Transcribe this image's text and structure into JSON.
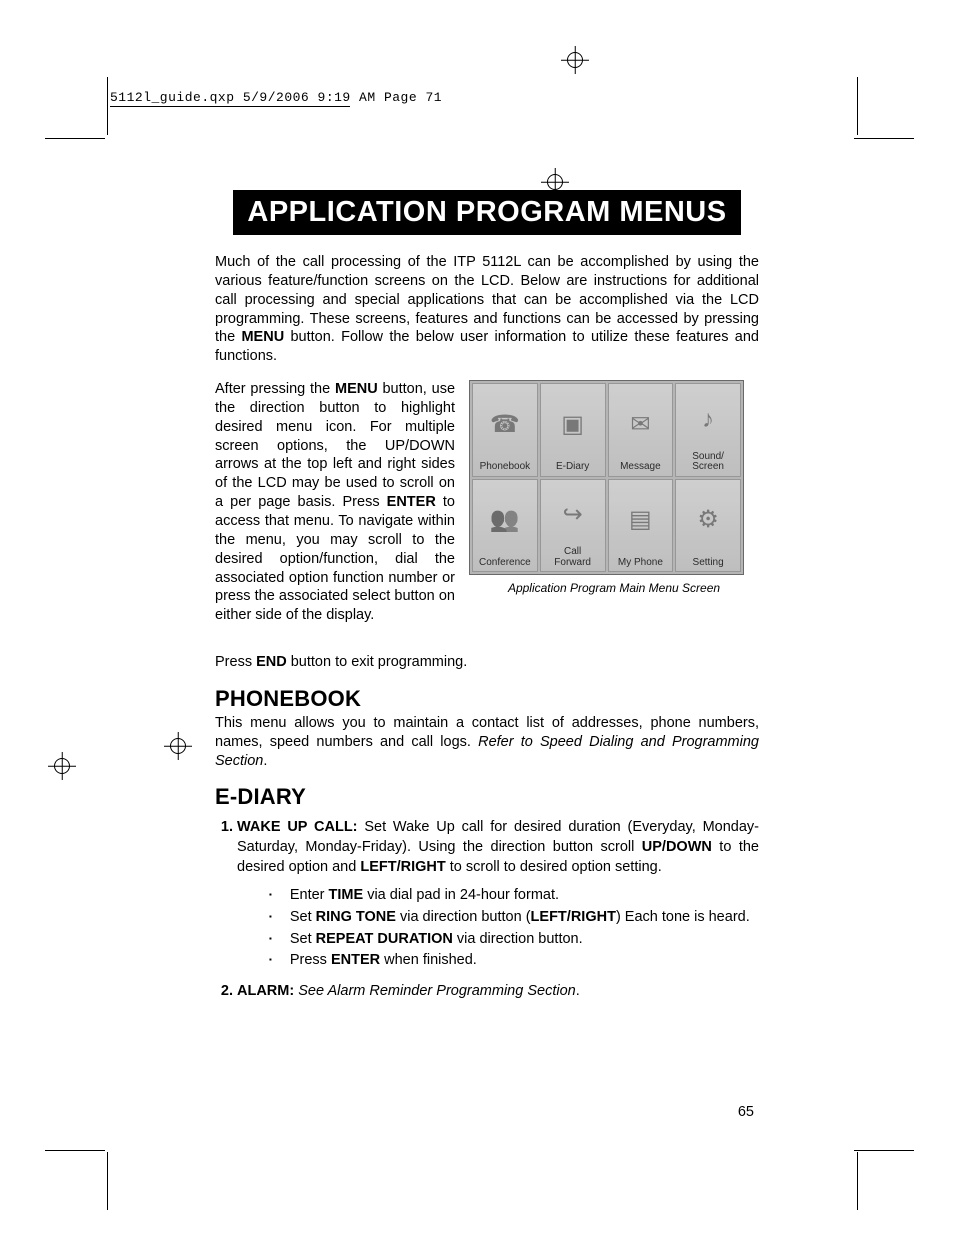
{
  "meta_header": "5112l_guide.qxp  5/9/2006  9:19 AM  Page 71",
  "title": "APPLICATION PROGRAM MENUS",
  "intro_para_pre": "Much of the call processing of the ITP 5112L can be accomplished by using the various feature/function screens on the LCD. Below are instructions for additional call processing and special applications that can be accomplished via the LCD programming. These screens, features and functions can be accessed by pressing the ",
  "intro_bold": "MENU",
  "intro_para_post": " button. Follow the below user information to utilize these features and functions.",
  "para2_pre": "After pressing the ",
  "para2_b1": "MENU",
  "para2_mid1": " button, use the direction button to highlight desired menu icon. For multiple screen options, the UP/DOWN arrows at the top left and right sides of the LCD may be used to scroll on a per page basis. Press ",
  "para2_b2": "ENTER",
  "para2_mid2": " to access that menu. To navigate within the menu, you may scroll to the desired option/function, dial the associated option function number or press the associated select button on either side of the display.",
  "menu_items": {
    "c0": "Phonebook",
    "c1": "E-Diary",
    "c2": "Message",
    "c3": "Sound/\nScreen",
    "c4": "Conference",
    "c5": "Call\nForward",
    "c6": "My Phone",
    "c7": "Setting"
  },
  "fig_caption": "Application Program Main Menu Screen",
  "press_end_pre": "Press ",
  "press_end_b": "END",
  "press_end_post": " button to exit programming.",
  "sec_phonebook_h": "PHONEBOOK",
  "sec_phonebook_p_pre": "This menu allows you to maintain a contact list of addresses, phone numbers, names, speed numbers and call logs. ",
  "sec_phonebook_p_it": "Refer to Speed Dialing and Programming Section",
  "sec_phonebook_p_post": ".",
  "sec_ediary_h": "E-DIARY",
  "li1_b": "WAKE UP CALL:",
  "li1_t1": " Set Wake Up call for desired duration (Everyday, Monday-Saturday, Monday-Friday). Using the direction button scroll ",
  "li1_b2": "UP/DOWN",
  "li1_t2": " to the desired option and ",
  "li1_b3": "LEFT/RIGHT",
  "li1_t3": " to scroll to desired option setting.",
  "b1_pre": "Enter ",
  "b1_b": "TIME",
  "b1_post": " via dial pad in 24-hour format.",
  "b2_pre": "Set ",
  "b2_b": "RING TONE",
  "b2_mid": " via direction button (",
  "b2_b2": "LEFT/RIGHT",
  "b2_post": ") Each tone is heard.",
  "b3_pre": "Set ",
  "b3_b": "REPEAT DURATION",
  "b3_post": " via direction button.",
  "b4_pre": "Press ",
  "b4_b": "ENTER",
  "b4_post": " when finished.",
  "li2_b": "ALARM:",
  "li2_it": " See Alarm Reminder Programming Section",
  "li2_post": ".",
  "page_number": "65"
}
